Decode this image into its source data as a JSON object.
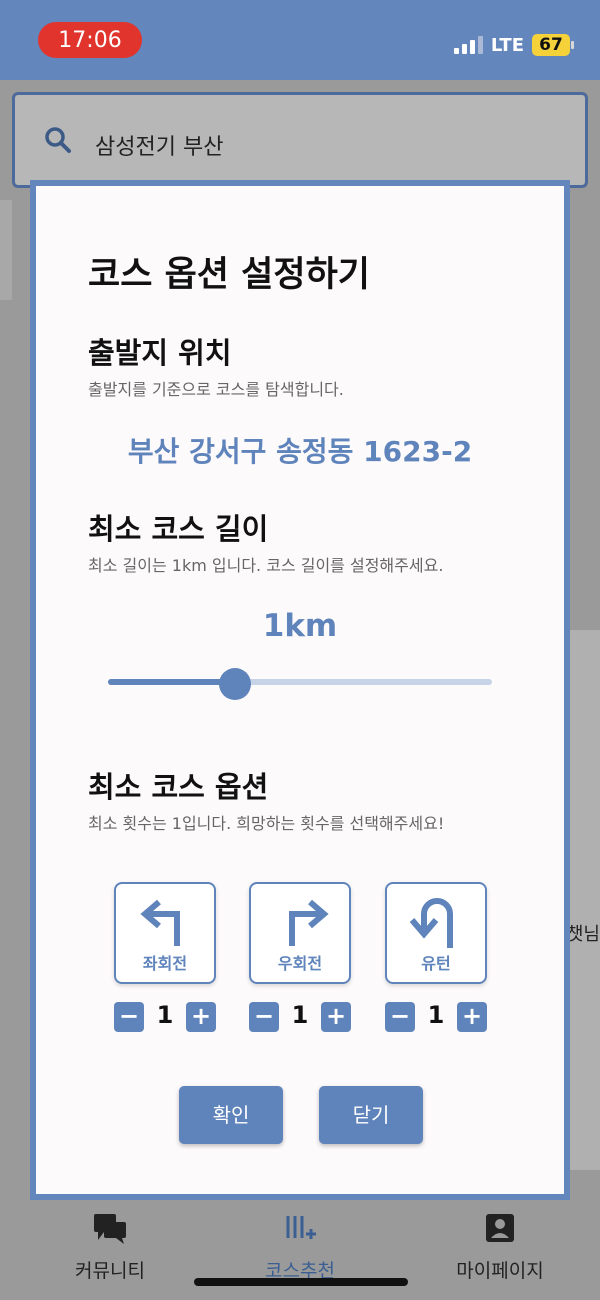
{
  "status_bar": {
    "time": "17:06",
    "network": "LTE",
    "battery": "67",
    "colors": {
      "bar": "#6386bd",
      "time_pill": "#e0342d",
      "battery": "#f5d23a"
    }
  },
  "search": {
    "value": "삼성전기 부산",
    "icon": "search-icon"
  },
  "background": {
    "partial_text": "챗님"
  },
  "modal": {
    "title": "코스 옵션 설정하기",
    "start": {
      "title": "출발지 위치",
      "desc": "출발지를 기준으로 코스를 탐색합니다.",
      "address": "부산 강서구 송정동 1623-2"
    },
    "length": {
      "title": "최소 코스 길이",
      "desc": "최소 길이는 1km 입니다. 코스 길이를 설정해주세요.",
      "value": "1km",
      "slider_fraction": 0.33
    },
    "turns": {
      "title": "최소 코스 옵션",
      "desc": "최소 횟수는 1입니다. 희망하는 횟수를 선택해주세요!",
      "options": [
        {
          "label": "좌회전",
          "icon": "turn-left-icon",
          "count": "1"
        },
        {
          "label": "우회전",
          "icon": "turn-right-icon",
          "count": "1"
        },
        {
          "label": "유턴",
          "icon": "u-turn-icon",
          "count": "1"
        }
      ],
      "minus": "−",
      "plus": "+"
    },
    "confirm_label": "확인",
    "close_label": "닫기",
    "accent_color": "#5f84bb"
  },
  "bottom_nav": {
    "items": [
      {
        "label": "커뮤니티",
        "icon": "chat-icon"
      },
      {
        "label": "코스추천",
        "icon": "course-icon",
        "active": true
      },
      {
        "label": "마이페이지",
        "icon": "profile-icon"
      }
    ]
  }
}
